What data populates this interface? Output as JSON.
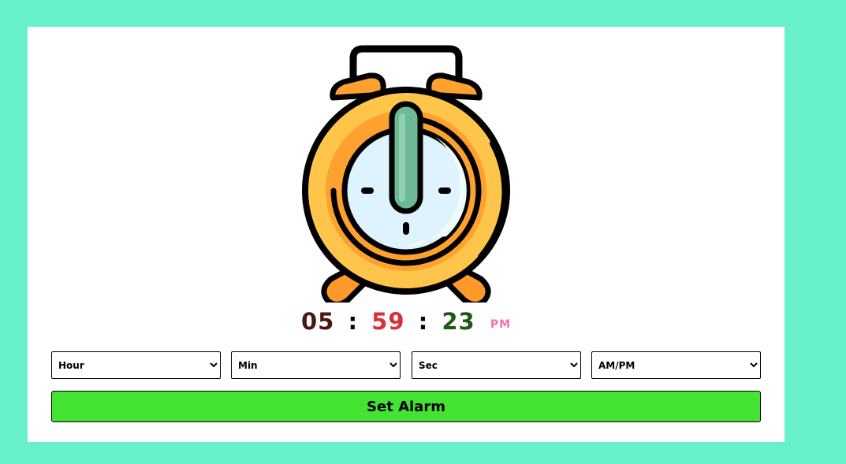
{
  "clock": {
    "hour": "05",
    "minute": "59",
    "second": "23",
    "separator": ":",
    "ampm": "PM"
  },
  "selects": {
    "hour": {
      "selected": "Hour"
    },
    "min": {
      "selected": "Min"
    },
    "sec": {
      "selected": "Sec"
    },
    "ampm": {
      "selected": "AM/PM"
    }
  },
  "actions": {
    "set_alarm_label": "Set Alarm"
  },
  "icons": {
    "illustration": "alarm-clock-icon"
  },
  "colors": {
    "page_background": "#67f0c9",
    "card_background": "#ffffff",
    "button_background": "#43e233",
    "hour_digits": "#4d1414",
    "minute_digits": "#d5313b",
    "second_digits": "#1e5a14",
    "ampm_text": "#ff6fa7",
    "clock_body": "#ffc44a",
    "clock_ring": "#ffa12e",
    "clock_face": "#dff3ff",
    "clock_hand": "#6db895"
  }
}
